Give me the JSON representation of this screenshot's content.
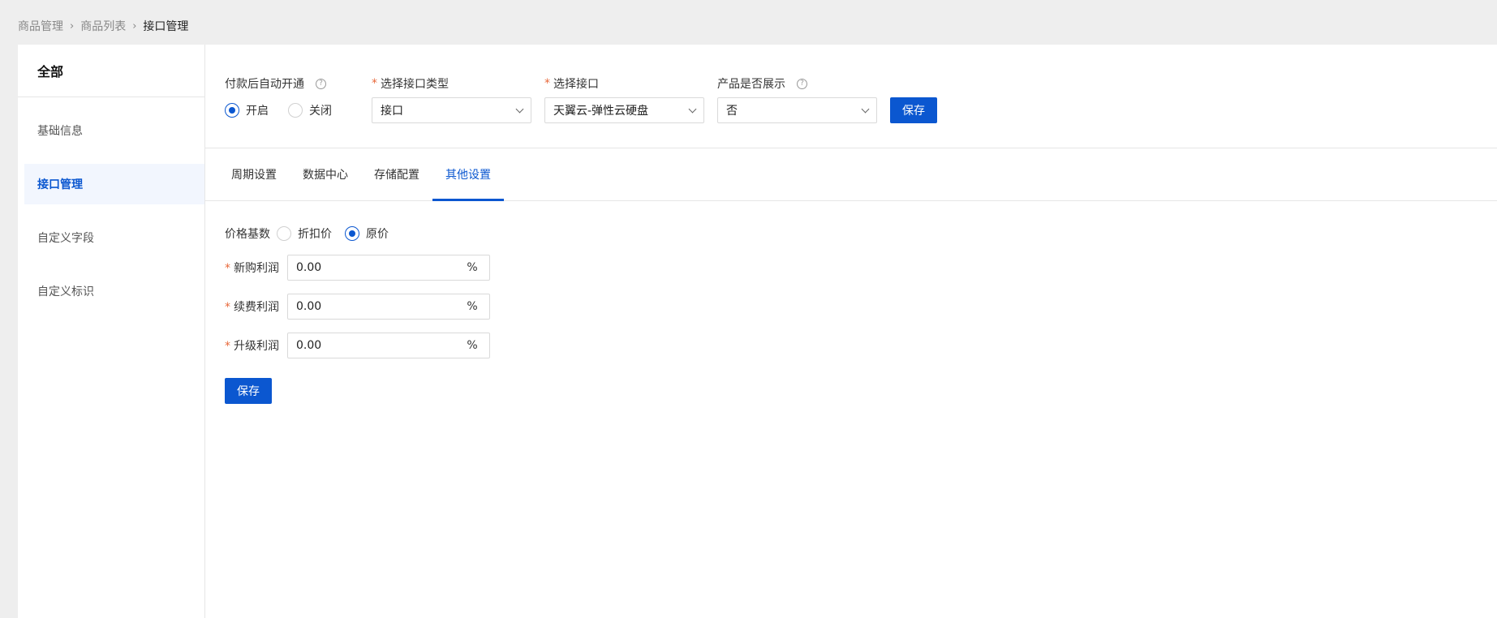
{
  "breadcrumb": {
    "item1": "商品管理",
    "item2": "商品列表",
    "current": "接口管理",
    "sep": "›"
  },
  "sidebar": {
    "title": "全部",
    "items": [
      {
        "label": "基础信息"
      },
      {
        "label": "接口管理"
      },
      {
        "label": "自定义字段"
      },
      {
        "label": "自定义标识"
      }
    ]
  },
  "top_form": {
    "auto_open": {
      "label": "付款后自动开通",
      "help": "?",
      "options": [
        "开启",
        "关闭"
      ],
      "selected": "开启"
    },
    "interface_type": {
      "required": "*",
      "label": "选择接口类型",
      "value": "接口"
    },
    "interface": {
      "required": "*",
      "label": "选择接口",
      "value": "天翼云-弹性云硬盘"
    },
    "display": {
      "label": "产品是否展示",
      "help": "?",
      "value": "否"
    },
    "save_label": "保存"
  },
  "tabs": [
    {
      "label": "周期设置"
    },
    {
      "label": "数据中心"
    },
    {
      "label": "存储配置"
    },
    {
      "label": "其他设置"
    }
  ],
  "active_tab": "其他设置",
  "other_settings": {
    "price_base": {
      "label": "价格基数",
      "options": [
        "折扣价",
        "原价"
      ],
      "selected": "原价"
    },
    "profits": [
      {
        "required": "*",
        "label": "新购利润",
        "value": "0.00",
        "unit": "%"
      },
      {
        "required": "*",
        "label": "续费利润",
        "value": "0.00",
        "unit": "%"
      },
      {
        "required": "*",
        "label": "升级利润",
        "value": "0.00",
        "unit": "%"
      }
    ],
    "save_label": "保存"
  },
  "colors": {
    "primary": "#0b57d0",
    "required": "#e8693b",
    "active_bg": "#f2f6fe"
  }
}
